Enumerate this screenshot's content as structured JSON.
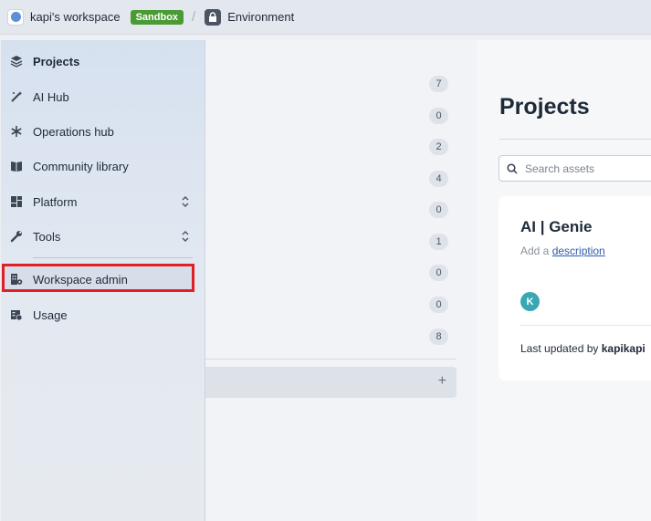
{
  "topbar": {
    "workspace_name": "kapi's workspace",
    "sandbox_badge": "Sandbox",
    "separator": "/",
    "environment_label": "Environment"
  },
  "menu": {
    "items": [
      {
        "label": "Projects",
        "icon": "layers-icon"
      },
      {
        "label": "AI Hub",
        "icon": "magic-wand-icon"
      },
      {
        "label": "Operations hub",
        "icon": "snowflake-icon"
      },
      {
        "label": "Community library",
        "icon": "book-icon"
      },
      {
        "label": "Platform",
        "icon": "grid-icon",
        "expandable": true
      },
      {
        "label": "Tools",
        "icon": "wrench-icon",
        "expandable": true
      },
      {
        "label": "Workspace admin",
        "icon": "building-gear-icon",
        "highlighted": true
      },
      {
        "label": "Usage",
        "icon": "usage-icon"
      }
    ]
  },
  "counts": [
    "7",
    "0",
    "2",
    "4",
    "0",
    "1",
    "0",
    "0",
    "8"
  ],
  "add_bar": {
    "plus": "+"
  },
  "main": {
    "title": "Projects",
    "search_placeholder": "Search assets",
    "card": {
      "title": "AI | Genie",
      "desc_prefix": "Add a ",
      "desc_link": "description",
      "avatar_initial": "K",
      "updated_prefix": "Last updated by ",
      "updated_by": "kapikapi"
    }
  },
  "colors": {
    "sandbox": "#4b9b34",
    "highlight_border": "#e01f26",
    "avatar": "#3aa8b4",
    "link": "#2f5bab"
  }
}
